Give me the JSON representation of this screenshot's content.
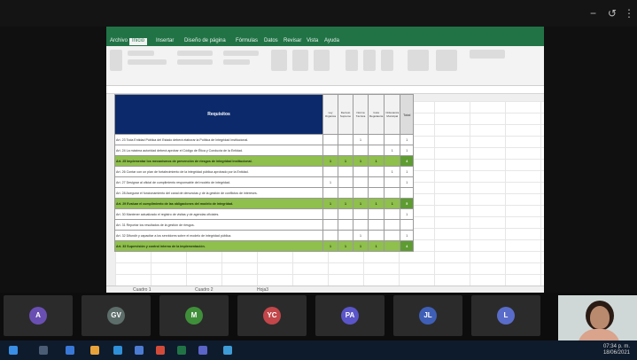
{
  "excel": {
    "tabs": [
      "Archivo",
      "Inicio",
      "Insertar",
      "Diseño de página",
      "Fórmulas",
      "Datos",
      "Revisar",
      "Vista",
      "Ayuda"
    ],
    "table": {
      "header": "Requisitos",
      "subheaders": [
        "Ley Orgánica",
        "Decreto Supremo",
        "Norma Técnica",
        "Guía Regulatoria",
        "Ordenanza Municipal"
      ],
      "total_header": "Total",
      "rows": [
        {
          "text": "Art. 23 Toda Entidad Pública del Estado deberá elaborar la Política de Integridad Institucional.",
          "marks": [
            "",
            "",
            "1",
            "",
            ""
          ],
          "total": "1",
          "green": false
        },
        {
          "text": "Art. 24 La máxima autoridad deberá aprobar el Código de Ética y Conducta de la Entidad.",
          "marks": [
            "",
            "",
            "",
            "",
            "1"
          ],
          "total": "1",
          "green": false
        },
        {
          "text": "Art. 25 Implementar los mecanismos de prevención de riesgos de integridad institucional.",
          "marks": [
            "1",
            "1",
            "1",
            "1",
            ""
          ],
          "total": "4",
          "green": true
        },
        {
          "text": "Art. 26 Contar con un plan de fortalecimiento de la integridad pública aprobado por la Entidad.",
          "marks": [
            "",
            "",
            "",
            "",
            "1"
          ],
          "total": "1",
          "green": false
        },
        {
          "text": "Art. 27 Designar al oficial de cumplimiento responsable del modelo de integridad.",
          "marks": [
            "1",
            "",
            "",
            "",
            ""
          ],
          "total": "1",
          "green": false
        },
        {
          "text": "Art. 28 Asegurar el funcionamiento del canal de denuncias y de la gestión de conflictos de intereses.",
          "marks": [
            "",
            "",
            "",
            "",
            ""
          ],
          "total": "",
          "green": false
        },
        {
          "text": "Art. 29 Evaluar el cumplimiento de las obligaciones del modelo de integridad.",
          "marks": [
            "1",
            "1",
            "1",
            "1",
            "1"
          ],
          "total": "5",
          "green": true
        },
        {
          "text": "Art. 30 Mantener actualizado el registro de visitas y de agendas oficiales.",
          "marks": [
            "",
            "",
            "",
            "",
            ""
          ],
          "total": "1",
          "green": false
        },
        {
          "text": "Art. 31 Reportar los resultados de la gestión de riesgos.",
          "marks": [
            "",
            "",
            "",
            "",
            ""
          ],
          "total": "",
          "green": false
        },
        {
          "text": "Art. 32 Difundir y capacitar a los servidores sobre el modelo de integridad pública.",
          "marks": [
            "",
            "",
            "1",
            "",
            ""
          ],
          "total": "1",
          "green": false
        },
        {
          "text": "Art. 33 Supervisión y control interno de la implementación.",
          "marks": [
            "1",
            "1",
            "1",
            "1",
            ""
          ],
          "total": "4",
          "green": true
        }
      ]
    },
    "sheet_tabs": [
      "Cuadro 1",
      "Cuadro 2",
      "Hoja3"
    ]
  },
  "participants": [
    {
      "initials": "A",
      "color": "#6a4fb3"
    },
    {
      "initials": "GV",
      "color": "#5d6d6a"
    },
    {
      "initials": "M",
      "color": "#3f8f3a"
    },
    {
      "initials": "YC",
      "color": "#c2464a"
    },
    {
      "initials": "PA",
      "color": "#5a55c8"
    },
    {
      "initials": "JL",
      "color": "#3f5fb7"
    },
    {
      "initials": "L",
      "color": "#5a6cc9"
    }
  ],
  "tray": {
    "time": "07:34 p. m.",
    "date": "18/06/2021"
  }
}
